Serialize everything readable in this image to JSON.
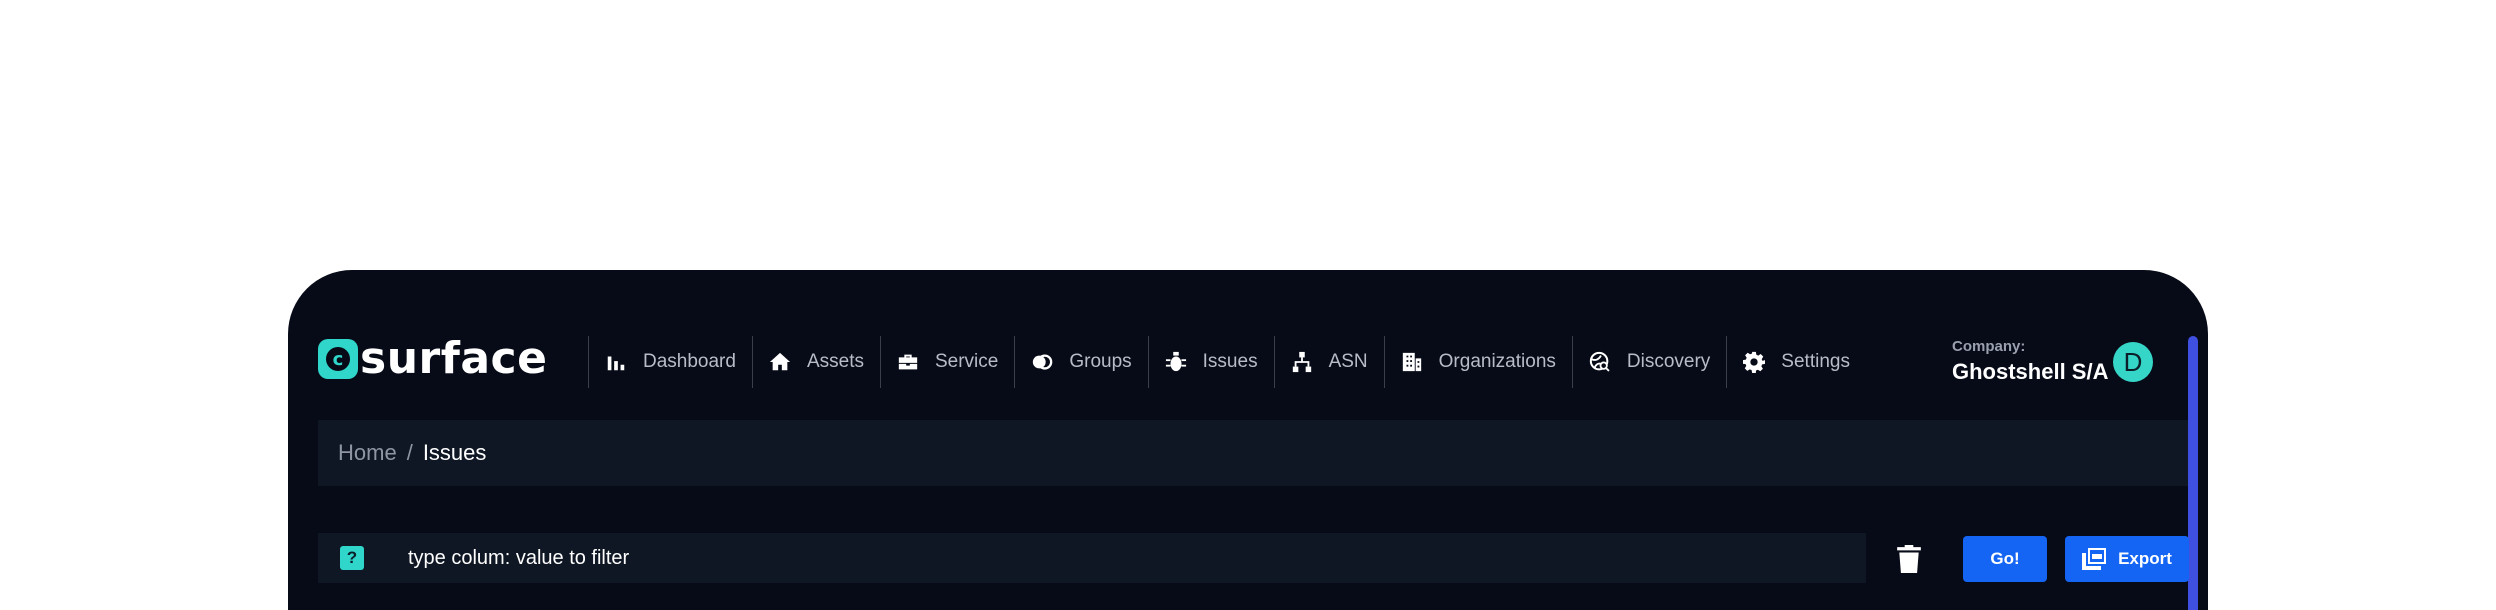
{
  "brand": {
    "logo_text": "surface",
    "logo_mark": "c"
  },
  "nav": [
    {
      "label": "Dashboard",
      "icon": "bar-chart-icon"
    },
    {
      "label": "Assets",
      "icon": "home-icon"
    },
    {
      "label": "Service",
      "icon": "toolbox-icon"
    },
    {
      "label": "Groups",
      "icon": "group-icon"
    },
    {
      "label": "Issues",
      "icon": "bug-icon"
    },
    {
      "label": "ASN",
      "icon": "sitemap-icon"
    },
    {
      "label": "Organizations",
      "icon": "building-icon"
    },
    {
      "label": "Discovery",
      "icon": "globe-search-icon"
    },
    {
      "label": "Settings",
      "icon": "gear-icon"
    }
  ],
  "company": {
    "label": "Company:",
    "name": "Ghostshell S/A"
  },
  "user": {
    "avatar_initial": "D",
    "avatar_color": "#35d6c8"
  },
  "breadcrumb": {
    "home": "Home",
    "separator": "/",
    "current": "Issues"
  },
  "filter": {
    "help": "?",
    "placeholder": "type colum: value to filter",
    "value": ""
  },
  "actions": {
    "go": "Go!",
    "export": "Export"
  },
  "colors": {
    "accent": "#2fd6c9",
    "button": "#1565f5",
    "background": "#070b18",
    "panel": "#0f1724"
  }
}
